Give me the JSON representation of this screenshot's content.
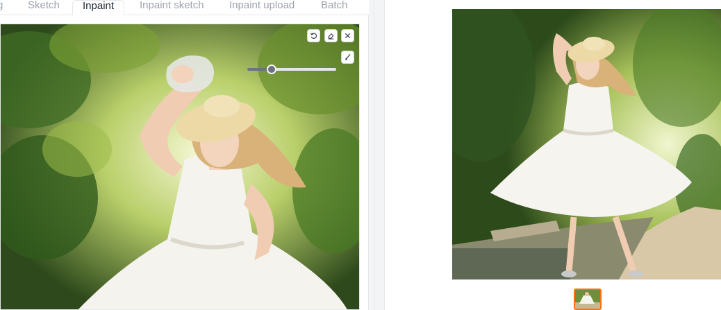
{
  "tabs": [
    {
      "label": "g",
      "active": false
    },
    {
      "label": "Sketch",
      "active": false
    },
    {
      "label": "Inpaint",
      "active": true
    },
    {
      "label": "Inpaint sketch",
      "active": false
    },
    {
      "label": "Inpaint upload",
      "active": false
    },
    {
      "label": "Batch",
      "active": false
    }
  ],
  "canvas_tools": {
    "undo": "undo-icon",
    "clear": "eraser-icon",
    "close": "close-icon",
    "brush": "brush-icon",
    "brush_size": 0.27
  },
  "colors": {
    "accent": "#f97316",
    "border": "#e5e7eb",
    "tab_inactive": "#9ca3af",
    "tab_active": "#1f2937"
  },
  "gallery": {
    "thumbnail_count": 1,
    "selected_index": 0
  }
}
